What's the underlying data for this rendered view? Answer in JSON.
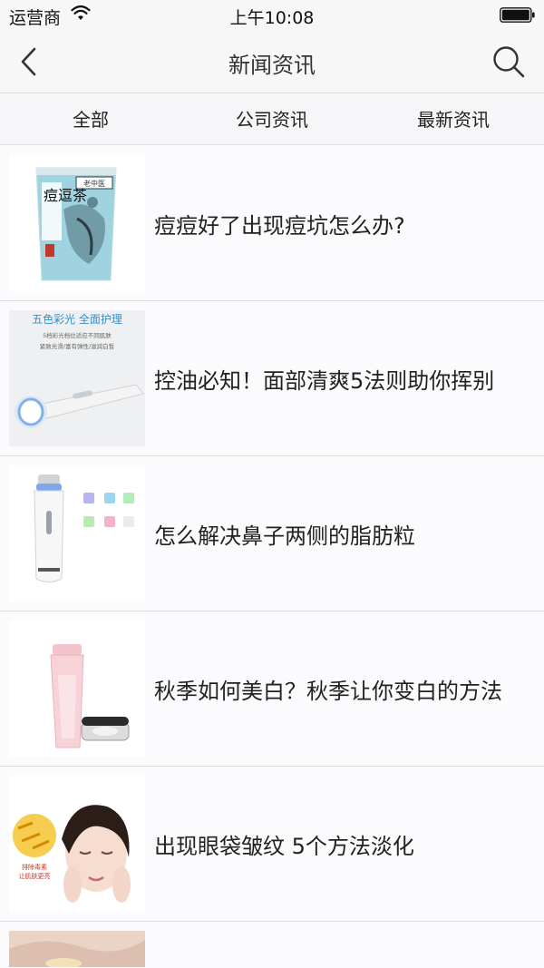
{
  "status_bar": {
    "carrier": "运营商",
    "time": "上午10:08",
    "wifi_icon": "wifi-icon",
    "battery_icon": "battery-icon"
  },
  "nav": {
    "title": "新闻资讯",
    "back_icon": "chevron-left-icon",
    "search_icon": "search-icon"
  },
  "tabs": [
    {
      "label": "全部"
    },
    {
      "label": "公司资讯"
    },
    {
      "label": "最新资讯"
    }
  ],
  "news": [
    {
      "title": "痘痘好了出现痘坑怎么办?",
      "thumb_text": [
        "痘逗茶",
        "老中医"
      ]
    },
    {
      "title": "控油必知！面部清爽5法则助你挥别",
      "thumb_text": [
        "五色彩光 全面护理",
        "5档彩光档位适应不同肌肤",
        "紧致光滑/富有弹性/滋润白皙"
      ]
    },
    {
      "title": "怎么解决鼻子两侧的脂肪粒",
      "thumb_text": []
    },
    {
      "title": "秋季如何美白？秋季让你变白的方法",
      "thumb_text": []
    },
    {
      "title": "出现眼袋皱纹 5个方法淡化",
      "thumb_text": [
        "排除毒素",
        "让肌肤更亮"
      ]
    }
  ],
  "colors": {
    "background": "#fbfbfd",
    "bar": "#f7f7f8",
    "divider": "#dcdcdc",
    "text": "#222222",
    "accent_blue": "#2e8fd6"
  }
}
